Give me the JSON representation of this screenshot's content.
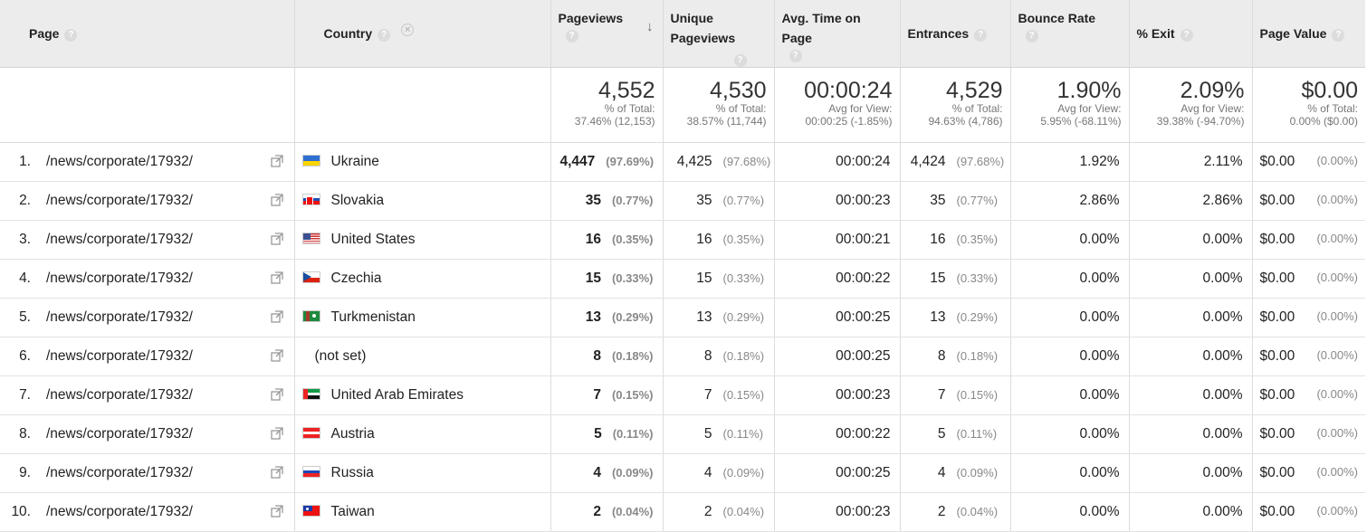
{
  "columns": {
    "page": "Page",
    "country": "Country",
    "pageviews": "Pageviews",
    "unique_pageviews": "Unique Pageviews",
    "avg_time": "Avg. Time on Page",
    "entrances": "Entrances",
    "bounce_rate": "Bounce Rate",
    "exit": "% Exit",
    "page_value": "Page Value"
  },
  "totals": {
    "pageviews": {
      "value": "4,552",
      "label": "% of Total:",
      "detail": "37.46% (12,153)"
    },
    "unique_pageviews": {
      "value": "4,530",
      "label": "% of Total:",
      "detail": "38.57% (11,744)"
    },
    "avg_time": {
      "value": "00:00:24",
      "label": "Avg for View:",
      "detail": "00:00:25 (-1.85%)"
    },
    "entrances": {
      "value": "4,529",
      "label": "% of Total:",
      "detail": "94.63% (4,786)"
    },
    "bounce_rate": {
      "value": "1.90%",
      "label": "Avg for View:",
      "detail": "5.95% (-68.11%)"
    },
    "exit": {
      "value": "2.09%",
      "label": "Avg for View:",
      "detail": "39.38% (-94.70%)"
    },
    "page_value": {
      "value": "$0.00",
      "label": "% of Total:",
      "detail": "0.00% ($0.00)"
    }
  },
  "rows": [
    {
      "num": "1.",
      "page": "/news/corporate/17932/",
      "country": "Ukraine",
      "flag": "ua",
      "pv": "4,447",
      "pv_pct": "(97.69%)",
      "upv": "4,425",
      "upv_pct": "(97.68%)",
      "avg": "00:00:24",
      "ent": "4,424",
      "ent_pct": "(97.68%)",
      "br": "1.92%",
      "exit": "2.11%",
      "val": "$0.00",
      "val_pct": "(0.00%)"
    },
    {
      "num": "2.",
      "page": "/news/corporate/17932/",
      "country": "Slovakia",
      "flag": "sk",
      "pv": "35",
      "pv_pct": "(0.77%)",
      "upv": "35",
      "upv_pct": "(0.77%)",
      "avg": "00:00:23",
      "ent": "35",
      "ent_pct": "(0.77%)",
      "br": "2.86%",
      "exit": "2.86%",
      "val": "$0.00",
      "val_pct": "(0.00%)"
    },
    {
      "num": "3.",
      "page": "/news/corporate/17932/",
      "country": "United States",
      "flag": "us",
      "pv": "16",
      "pv_pct": "(0.35%)",
      "upv": "16",
      "upv_pct": "(0.35%)",
      "avg": "00:00:21",
      "ent": "16",
      "ent_pct": "(0.35%)",
      "br": "0.00%",
      "exit": "0.00%",
      "val": "$0.00",
      "val_pct": "(0.00%)"
    },
    {
      "num": "4.",
      "page": "/news/corporate/17932/",
      "country": "Czechia",
      "flag": "cz",
      "pv": "15",
      "pv_pct": "(0.33%)",
      "upv": "15",
      "upv_pct": "(0.33%)",
      "avg": "00:00:22",
      "ent": "15",
      "ent_pct": "(0.33%)",
      "br": "0.00%",
      "exit": "0.00%",
      "val": "$0.00",
      "val_pct": "(0.00%)"
    },
    {
      "num": "5.",
      "page": "/news/corporate/17932/",
      "country": "Turkmenistan",
      "flag": "tm",
      "pv": "13",
      "pv_pct": "(0.29%)",
      "upv": "13",
      "upv_pct": "(0.29%)",
      "avg": "00:00:25",
      "ent": "13",
      "ent_pct": "(0.29%)",
      "br": "0.00%",
      "exit": "0.00%",
      "val": "$0.00",
      "val_pct": "(0.00%)"
    },
    {
      "num": "6.",
      "page": "/news/corporate/17932/",
      "country": "(not set)",
      "flag": "",
      "pv": "8",
      "pv_pct": "(0.18%)",
      "upv": "8",
      "upv_pct": "(0.18%)",
      "avg": "00:00:25",
      "ent": "8",
      "ent_pct": "(0.18%)",
      "br": "0.00%",
      "exit": "0.00%",
      "val": "$0.00",
      "val_pct": "(0.00%)"
    },
    {
      "num": "7.",
      "page": "/news/corporate/17932/",
      "country": "United Arab Emirates",
      "flag": "ae",
      "pv": "7",
      "pv_pct": "(0.15%)",
      "upv": "7",
      "upv_pct": "(0.15%)",
      "avg": "00:00:23",
      "ent": "7",
      "ent_pct": "(0.15%)",
      "br": "0.00%",
      "exit": "0.00%",
      "val": "$0.00",
      "val_pct": "(0.00%)"
    },
    {
      "num": "8.",
      "page": "/news/corporate/17932/",
      "country": "Austria",
      "flag": "at",
      "pv": "5",
      "pv_pct": "(0.11%)",
      "upv": "5",
      "upv_pct": "(0.11%)",
      "avg": "00:00:22",
      "ent": "5",
      "ent_pct": "(0.11%)",
      "br": "0.00%",
      "exit": "0.00%",
      "val": "$0.00",
      "val_pct": "(0.00%)"
    },
    {
      "num": "9.",
      "page": "/news/corporate/17932/",
      "country": "Russia",
      "flag": "ru",
      "pv": "4",
      "pv_pct": "(0.09%)",
      "upv": "4",
      "upv_pct": "(0.09%)",
      "avg": "00:00:25",
      "ent": "4",
      "ent_pct": "(0.09%)",
      "br": "0.00%",
      "exit": "0.00%",
      "val": "$0.00",
      "val_pct": "(0.00%)"
    },
    {
      "num": "10.",
      "page": "/news/corporate/17932/",
      "country": "Taiwan",
      "flag": "tw",
      "pv": "2",
      "pv_pct": "(0.04%)",
      "upv": "2",
      "upv_pct": "(0.04%)",
      "avg": "00:00:23",
      "ent": "2",
      "ent_pct": "(0.04%)",
      "br": "0.00%",
      "exit": "0.00%",
      "val": "$0.00",
      "val_pct": "(0.00%)"
    }
  ],
  "icons": {
    "help": "help-icon",
    "remove": "remove-dimension-icon",
    "sort": "sort-desc-arrow-icon",
    "open": "open-link-icon"
  }
}
